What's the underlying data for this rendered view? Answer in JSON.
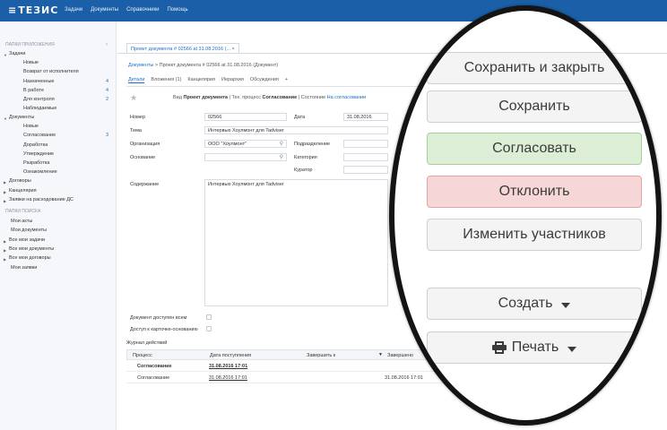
{
  "app": {
    "logo": "ТЕЗИС",
    "menu": [
      "Задачи",
      "Документы",
      "Справочники",
      "Помощь"
    ]
  },
  "sidebar": {
    "collapse": "‹",
    "section_app": "ПАПКИ ПРИЛОЖЕНИЯ",
    "tasks": "Задачи",
    "task_items": [
      {
        "label": "Новые",
        "count": ""
      },
      {
        "label": "Возврат от исполнителя",
        "count": ""
      },
      {
        "label": "Назначенные",
        "count": "4"
      },
      {
        "label": "В работе",
        "count": "4"
      },
      {
        "label": "Для контроля",
        "count": "2"
      },
      {
        "label": "Наблюдаемые",
        "count": ""
      }
    ],
    "documents": "Документы",
    "doc_items": [
      {
        "label": "Новые",
        "count": ""
      },
      {
        "label": "Согласование",
        "count": "3"
      },
      {
        "label": "Доработка",
        "count": ""
      },
      {
        "label": "Утверждение",
        "count": ""
      },
      {
        "label": "Разработка",
        "count": ""
      },
      {
        "label": "Ознакомление",
        "count": ""
      }
    ],
    "contracts": "Договоры",
    "office": "Канцелярия",
    "requests": "Заявки на расходование ДС",
    "section_search": "ПАПКИ ПОИСКА",
    "search_items": [
      "Мои акты",
      "Мои документы"
    ],
    "search_groups": [
      "Все мои задачи",
      "Все мои документы",
      "Все мои договоры"
    ],
    "my_requests": "Мои заявки"
  },
  "main": {
    "doc_tab": "Проект документа # 02566 at 31.08.2016 (... ×",
    "breadcrumb_link": "Документы",
    "breadcrumb_rest": " > Проект документа # 02566 at 31.08.2016 (Документ)",
    "subtabs": [
      "Детали",
      "Вложения (1)",
      "Канцелярия",
      "Иерархия",
      "Обсуждения",
      "+"
    ],
    "toolbar": {
      "kind_label": "Вид",
      "kind_value": "Проект документа",
      "process_label": " | Тех. процесс",
      "process_value": "Согласование",
      "state_label": " | Состояние",
      "state_value": "На согласовании"
    },
    "fields": {
      "number_label": "Номер",
      "number_value": "02566",
      "date_label": "Дата",
      "date_value": "31.08.2016",
      "theme_label": "Тема",
      "theme_value": "Интервью Хоулмонт для Tadviser",
      "org_label": "Организация",
      "org_value": "ООО \"Хоулмонт\"",
      "dept_label": "Подразделение",
      "basis_label": "Основание",
      "category_label": "Категория",
      "curator_label": "Куратор",
      "content_label": "Содержание",
      "content_value": "Интервью Хоулмонт для Tadviser",
      "access_all_label": "Документ доступен всем",
      "access_card_label": "Доступ к карточке-основанию"
    },
    "journal": {
      "title": "Журнал действий",
      "headers": [
        "Процесс",
        "Дата поступления",
        "Завершить к",
        "Завершено"
      ],
      "rows": [
        {
          "process": "Согласование",
          "received": "31.08.2016 17:01",
          "due": "",
          "done": ""
        },
        {
          "process": "Согласование",
          "received": "31.08.2016 17:01",
          "due": "",
          "done": "31.08.2016 17:01"
        }
      ]
    }
  },
  "lens": {
    "save_close": "Сохранить и закрыть",
    "save": "Сохранить",
    "approve": "Согласовать",
    "reject": "Отклонить",
    "change_participants": "Изменить участников",
    "create": "Создать",
    "print": "Печать"
  },
  "colors": {
    "topbar": "#1a5fa8",
    "link": "#1a6fc9",
    "approve_bg": "#dcefd6",
    "reject_bg": "#f6d6d6",
    "lens_border": "#141414"
  }
}
